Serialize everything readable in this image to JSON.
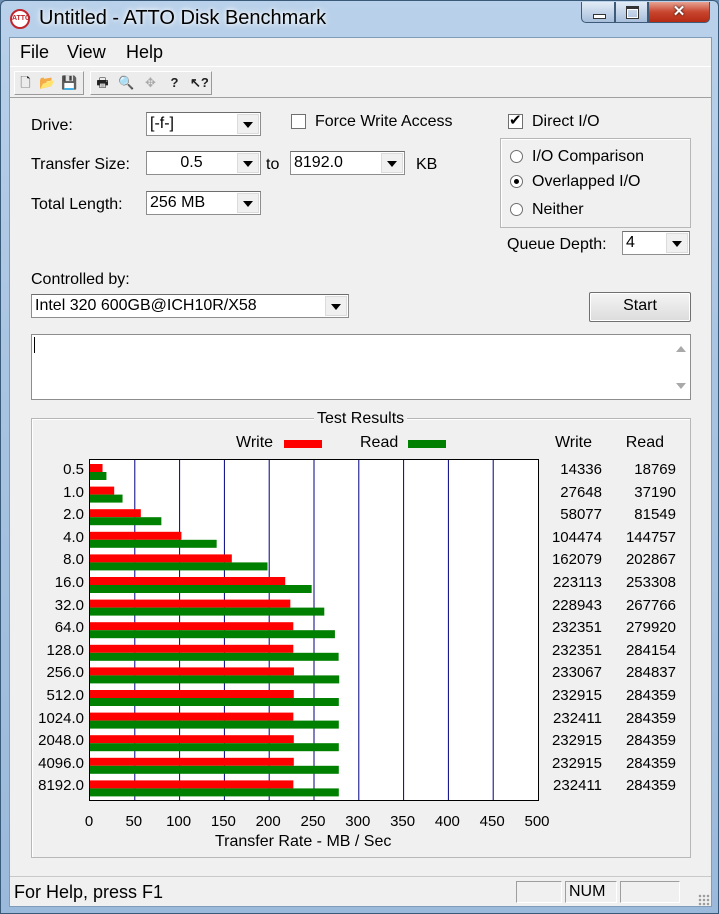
{
  "window": {
    "title": "Untitled - ATTO Disk Benchmark",
    "icon": "ATTO"
  },
  "menu": [
    "File",
    "View",
    "Help"
  ],
  "toolbar": [
    "new-icon",
    "open-icon",
    "save-icon",
    "print-icon",
    "print-preview-icon",
    "move-icon",
    "help-icon",
    "context-help-icon"
  ],
  "form": {
    "drive_label": "Drive:",
    "drive_value": "[-f-]",
    "force_write_label": "Force Write Access",
    "force_write_checked": false,
    "direct_io_label": "Direct I/O",
    "direct_io_checked": true,
    "transfer_size_label": "Transfer Size:",
    "transfer_from": "0.5",
    "to_label": "to",
    "transfer_to": "8192.0",
    "kb_label": "KB",
    "total_length_label": "Total Length:",
    "total_length_value": "256 MB",
    "io_comparison_label": "I/O Comparison",
    "overlapped_io_label": "Overlapped I/O",
    "neither_label": "Neither",
    "selected_mode": "Overlapped I/O",
    "queue_depth_label": "Queue Depth:",
    "queue_depth_value": "4",
    "controlled_by_label": "Controlled by:",
    "controlled_by_value": "Intel 320 600GB@ICH10R/X58",
    "start_label": "Start"
  },
  "results": {
    "title": "Test Results",
    "write_legend": "Write",
    "read_legend": "Read",
    "write_header": "Write",
    "read_header": "Read"
  },
  "chart_data": {
    "type": "bar",
    "orientation": "horizontal",
    "xlabel": "Transfer Rate - MB / Sec",
    "xlim": [
      0,
      500
    ],
    "xticks": [
      0,
      50,
      100,
      150,
      200,
      250,
      300,
      350,
      400,
      450,
      500
    ],
    "categories": [
      "0.5",
      "1.0",
      "2.0",
      "4.0",
      "8.0",
      "16.0",
      "32.0",
      "64.0",
      "128.0",
      "256.0",
      "512.0",
      "1024.0",
      "2048.0",
      "4096.0",
      "8192.0"
    ],
    "series": [
      {
        "name": "Write",
        "color": "#ff0000",
        "values": [
          14336,
          27648,
          58077,
          104474,
          162079,
          223113,
          228943,
          232351,
          232351,
          233067,
          232915,
          232411,
          232915,
          232915,
          232411
        ]
      },
      {
        "name": "Read",
        "color": "#008000",
        "values": [
          18769,
          37190,
          81549,
          144757,
          202867,
          253308,
          267766,
          279920,
          284154,
          284837,
          284359,
          284359,
          284359,
          284359,
          284359
        ]
      }
    ],
    "grid": true,
    "legend": "top"
  },
  "status": {
    "help_text": "For Help, press F1",
    "num": "NUM"
  }
}
